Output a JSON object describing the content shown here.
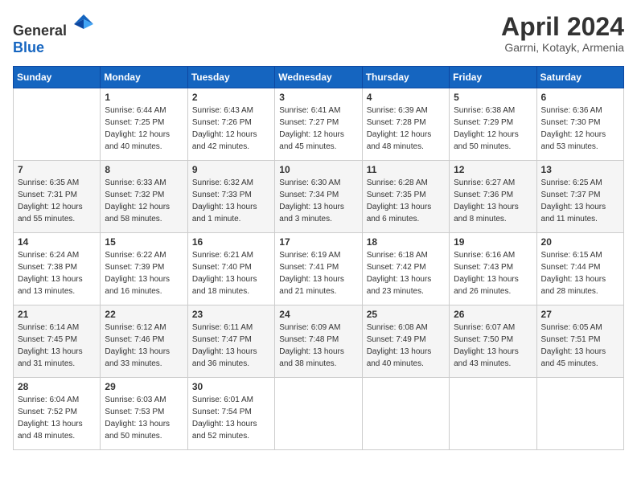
{
  "header": {
    "logo": {
      "general": "General",
      "blue": "Blue"
    },
    "title": "April 2024",
    "location": "Garrni, Kotayk, Armenia"
  },
  "calendar": {
    "columns": [
      "Sunday",
      "Monday",
      "Tuesday",
      "Wednesday",
      "Thursday",
      "Friday",
      "Saturday"
    ],
    "weeks": [
      [
        {
          "day": null
        },
        {
          "day": "1",
          "sunrise": "6:44 AM",
          "sunset": "7:25 PM",
          "daylight": "12 hours and 40 minutes."
        },
        {
          "day": "2",
          "sunrise": "6:43 AM",
          "sunset": "7:26 PM",
          "daylight": "12 hours and 42 minutes."
        },
        {
          "day": "3",
          "sunrise": "6:41 AM",
          "sunset": "7:27 PM",
          "daylight": "12 hours and 45 minutes."
        },
        {
          "day": "4",
          "sunrise": "6:39 AM",
          "sunset": "7:28 PM",
          "daylight": "12 hours and 48 minutes."
        },
        {
          "day": "5",
          "sunrise": "6:38 AM",
          "sunset": "7:29 PM",
          "daylight": "12 hours and 50 minutes."
        },
        {
          "day": "6",
          "sunrise": "6:36 AM",
          "sunset": "7:30 PM",
          "daylight": "12 hours and 53 minutes."
        }
      ],
      [
        {
          "day": "7",
          "sunrise": "6:35 AM",
          "sunset": "7:31 PM",
          "daylight": "12 hours and 55 minutes."
        },
        {
          "day": "8",
          "sunrise": "6:33 AM",
          "sunset": "7:32 PM",
          "daylight": "12 hours and 58 minutes."
        },
        {
          "day": "9",
          "sunrise": "6:32 AM",
          "sunset": "7:33 PM",
          "daylight": "13 hours and 1 minute."
        },
        {
          "day": "10",
          "sunrise": "6:30 AM",
          "sunset": "7:34 PM",
          "daylight": "13 hours and 3 minutes."
        },
        {
          "day": "11",
          "sunrise": "6:28 AM",
          "sunset": "7:35 PM",
          "daylight": "13 hours and 6 minutes."
        },
        {
          "day": "12",
          "sunrise": "6:27 AM",
          "sunset": "7:36 PM",
          "daylight": "13 hours and 8 minutes."
        },
        {
          "day": "13",
          "sunrise": "6:25 AM",
          "sunset": "7:37 PM",
          "daylight": "13 hours and 11 minutes."
        }
      ],
      [
        {
          "day": "14",
          "sunrise": "6:24 AM",
          "sunset": "7:38 PM",
          "daylight": "13 hours and 13 minutes."
        },
        {
          "day": "15",
          "sunrise": "6:22 AM",
          "sunset": "7:39 PM",
          "daylight": "13 hours and 16 minutes."
        },
        {
          "day": "16",
          "sunrise": "6:21 AM",
          "sunset": "7:40 PM",
          "daylight": "13 hours and 18 minutes."
        },
        {
          "day": "17",
          "sunrise": "6:19 AM",
          "sunset": "7:41 PM",
          "daylight": "13 hours and 21 minutes."
        },
        {
          "day": "18",
          "sunrise": "6:18 AM",
          "sunset": "7:42 PM",
          "daylight": "13 hours and 23 minutes."
        },
        {
          "day": "19",
          "sunrise": "6:16 AM",
          "sunset": "7:43 PM",
          "daylight": "13 hours and 26 minutes."
        },
        {
          "day": "20",
          "sunrise": "6:15 AM",
          "sunset": "7:44 PM",
          "daylight": "13 hours and 28 minutes."
        }
      ],
      [
        {
          "day": "21",
          "sunrise": "6:14 AM",
          "sunset": "7:45 PM",
          "daylight": "13 hours and 31 minutes."
        },
        {
          "day": "22",
          "sunrise": "6:12 AM",
          "sunset": "7:46 PM",
          "daylight": "13 hours and 33 minutes."
        },
        {
          "day": "23",
          "sunrise": "6:11 AM",
          "sunset": "7:47 PM",
          "daylight": "13 hours and 36 minutes."
        },
        {
          "day": "24",
          "sunrise": "6:09 AM",
          "sunset": "7:48 PM",
          "daylight": "13 hours and 38 minutes."
        },
        {
          "day": "25",
          "sunrise": "6:08 AM",
          "sunset": "7:49 PM",
          "daylight": "13 hours and 40 minutes."
        },
        {
          "day": "26",
          "sunrise": "6:07 AM",
          "sunset": "7:50 PM",
          "daylight": "13 hours and 43 minutes."
        },
        {
          "day": "27",
          "sunrise": "6:05 AM",
          "sunset": "7:51 PM",
          "daylight": "13 hours and 45 minutes."
        }
      ],
      [
        {
          "day": "28",
          "sunrise": "6:04 AM",
          "sunset": "7:52 PM",
          "daylight": "13 hours and 48 minutes."
        },
        {
          "day": "29",
          "sunrise": "6:03 AM",
          "sunset": "7:53 PM",
          "daylight": "13 hours and 50 minutes."
        },
        {
          "day": "30",
          "sunrise": "6:01 AM",
          "sunset": "7:54 PM",
          "daylight": "13 hours and 52 minutes."
        },
        {
          "day": null
        },
        {
          "day": null
        },
        {
          "day": null
        },
        {
          "day": null
        }
      ]
    ]
  }
}
